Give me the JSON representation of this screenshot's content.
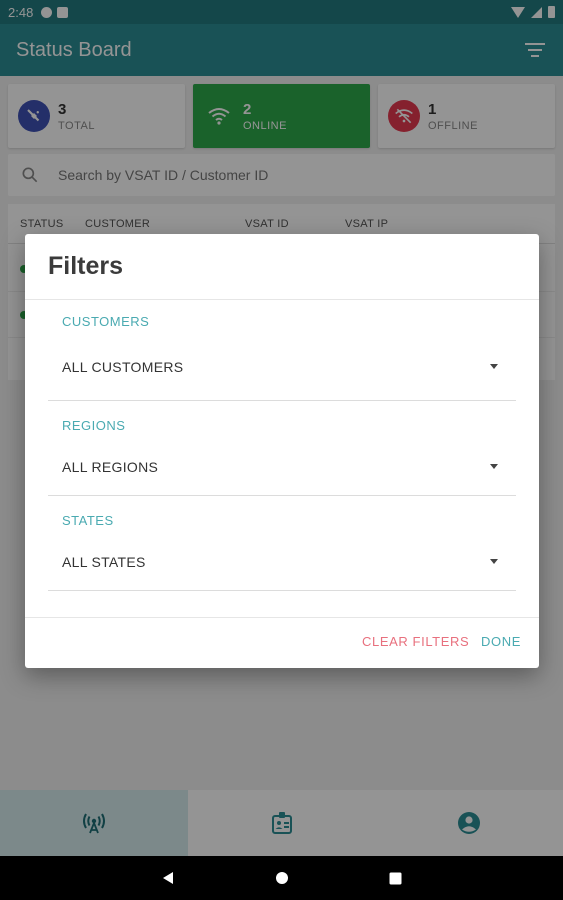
{
  "status_bar": {
    "time": "2:48"
  },
  "app_bar": {
    "title": "Status Board",
    "filter_icon": "filter-list-icon"
  },
  "summary": [
    {
      "count": "3",
      "label": "TOTAL",
      "icon": "satellite-icon",
      "icon_color": "#3f51b5"
    },
    {
      "count": "2",
      "label": "ONLINE",
      "icon": "wifi-icon",
      "active": true,
      "bg": "#2eaa4a"
    },
    {
      "count": "1",
      "label": "OFFLINE",
      "icon": "wifi-off-icon",
      "icon_color": "#e53950"
    }
  ],
  "search": {
    "placeholder": "Search by VSAT ID / Customer ID"
  },
  "table": {
    "headers": [
      "STATUS",
      "CUSTOMER",
      "VSAT ID",
      "VSAT IP"
    ]
  },
  "dialog": {
    "title": "Filters",
    "sections": [
      {
        "label": "CUSTOMERS",
        "value": "ALL CUSTOMERS"
      },
      {
        "label": "REGIONS",
        "value": "ALL REGIONS"
      },
      {
        "label": "STATES",
        "value": "ALL STATES"
      }
    ],
    "clear_label": "CLEAR FILTERS",
    "done_label": "DONE"
  },
  "bottom_nav": [
    {
      "icon": "antenna-icon",
      "active": true
    },
    {
      "icon": "badge-icon",
      "active": false
    },
    {
      "icon": "account-circle-icon",
      "active": false
    }
  ],
  "colors": {
    "primary": "#2b8d95",
    "accent": "#4aaab1",
    "online": "#2eaa4a",
    "offline": "#e53950",
    "clear_button": "#e8707e"
  }
}
